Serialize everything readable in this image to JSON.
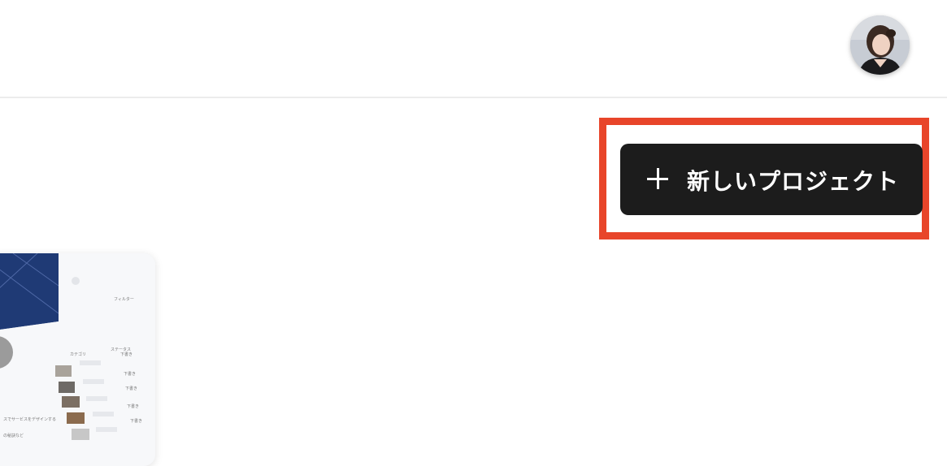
{
  "header": {
    "avatar_icon": "user-avatar"
  },
  "actions": {
    "new_project_label": "新しいプロジェクト",
    "new_project_icon": "plus-icon",
    "highlight_color": "#e8452a",
    "button_color": "#1c1c1c"
  },
  "project_card": {
    "thumbnail": {
      "filter_label": "フィルター",
      "col_a": "カテゴリ",
      "col_b": "ステータス",
      "status_draft": "下書き",
      "row_text_1": "スでサービスをデザインする",
      "row_text_2": "の秘訣など"
    }
  }
}
